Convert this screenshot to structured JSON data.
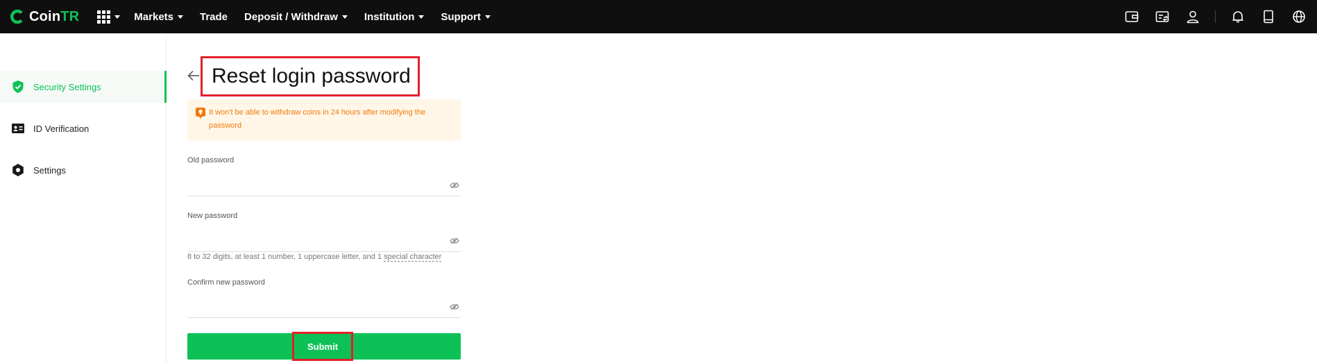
{
  "brand": {
    "name_prefix": "Coin",
    "name_suffix": "TR",
    "accent": "#0ec157"
  },
  "nav": {
    "items": [
      {
        "label": "Markets",
        "dropdown": true
      },
      {
        "label": "Trade",
        "dropdown": false
      },
      {
        "label": "Deposit / Withdraw",
        "dropdown": true
      },
      {
        "label": "Institution",
        "dropdown": true
      },
      {
        "label": "Support",
        "dropdown": true
      }
    ],
    "right_icons": [
      "wallet-icon",
      "orders-icon",
      "user-icon",
      "bell-icon",
      "mobile-app-icon",
      "globe-icon"
    ]
  },
  "sidebar": {
    "items": [
      {
        "label": "Security Settings",
        "icon": "shield-icon",
        "active": true
      },
      {
        "label": "ID Verification",
        "icon": "id-card-icon",
        "active": false
      },
      {
        "label": "Settings",
        "icon": "gear-icon",
        "active": false
      }
    ]
  },
  "page": {
    "title": "Reset login password",
    "notice_line1": "It won't be able to withdraw coins in 24 hours after modifying the",
    "notice_line2": "password",
    "old_password_label": "Old password",
    "new_password_label": "New password",
    "hint_text": "8 to 32 digits, at least 1 number, 1 uppercase letter, and 1 ",
    "hint_link": "special character",
    "confirm_password_label": "Confirm new password",
    "old_password_value": "",
    "new_password_value": "",
    "confirm_password_value": "",
    "submit_label": "Submit"
  },
  "colors": {
    "highlight_box": "#e3202a",
    "notice_bg": "#fff6e8",
    "notice_text": "#f07a0c"
  }
}
